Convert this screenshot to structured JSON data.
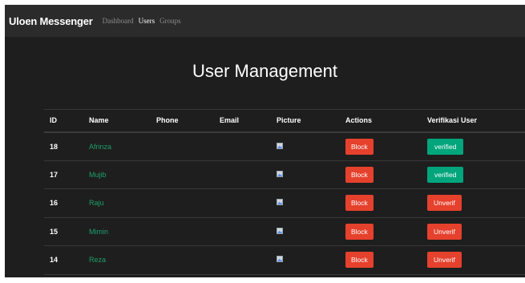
{
  "navbar": {
    "brand": "Uloen Messenger",
    "links": [
      {
        "label": "Dashboard",
        "active": false
      },
      {
        "label": "Users",
        "active": true
      },
      {
        "label": "Groups",
        "active": false
      }
    ]
  },
  "page": {
    "title": "User Management"
  },
  "table": {
    "headers": [
      "ID",
      "Name",
      "Phone",
      "Email",
      "Picture",
      "Actions",
      "Verifikasi User"
    ],
    "rows": [
      {
        "id": "18",
        "name": "Afrinza",
        "phone": "",
        "email": "",
        "picture_icon": "broken-image-icon",
        "action": "Block",
        "verify": "verified",
        "verify_status": "verified"
      },
      {
        "id": "17",
        "name": "Mujib",
        "phone": "",
        "email": "",
        "picture_icon": "broken-image-icon",
        "action": "Block",
        "verify": "verified",
        "verify_status": "verified"
      },
      {
        "id": "16",
        "name": "Raju",
        "phone": "",
        "email": "",
        "picture_icon": "broken-image-icon",
        "action": "Block",
        "verify": "Unverif",
        "verify_status": "unverified"
      },
      {
        "id": "15",
        "name": "Mimin",
        "phone": "",
        "email": "",
        "picture_icon": "broken-image-icon",
        "action": "Block",
        "verify": "Unverif",
        "verify_status": "unverified"
      },
      {
        "id": "14",
        "name": "Reza",
        "phone": "",
        "email": "",
        "picture_icon": "broken-image-icon",
        "action": "Block",
        "verify": "Unverif",
        "verify_status": "unverified"
      }
    ]
  },
  "colors": {
    "background": "#1e1e1e",
    "navbar": "#2b2b2b",
    "name_link": "#1f9e6e",
    "danger": "#e5412d",
    "success": "#00a57c"
  }
}
